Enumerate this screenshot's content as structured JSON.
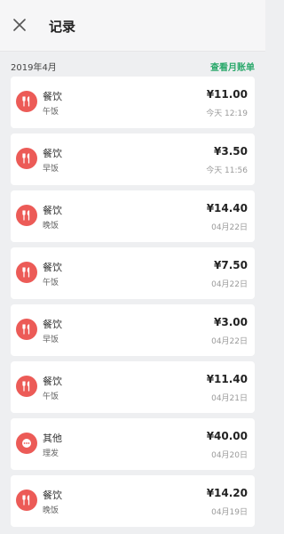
{
  "header": {
    "title": "记录"
  },
  "month": {
    "label": "2019年4月",
    "link": "查看月账单"
  },
  "records": [
    {
      "category": "餐饮",
      "note": "午饭",
      "amount": "¥11.00",
      "time": "今天 12:19",
      "icon": "fork-knife-icon"
    },
    {
      "category": "餐饮",
      "note": "早饭",
      "amount": "¥3.50",
      "time": "今天 11:56",
      "icon": "fork-knife-icon"
    },
    {
      "category": "餐饮",
      "note": "晚饭",
      "amount": "¥14.40",
      "time": "04月22日",
      "icon": "fork-knife-icon"
    },
    {
      "category": "餐饮",
      "note": "午饭",
      "amount": "¥7.50",
      "time": "04月22日",
      "icon": "fork-knife-icon"
    },
    {
      "category": "餐饮",
      "note": "早饭",
      "amount": "¥3.00",
      "time": "04月22日",
      "icon": "fork-knife-icon"
    },
    {
      "category": "餐饮",
      "note": "午饭",
      "amount": "¥11.40",
      "time": "04月21日",
      "icon": "fork-knife-icon"
    },
    {
      "category": "其他",
      "note": "理发",
      "amount": "¥40.00",
      "time": "04月20日",
      "icon": "more-dots-icon"
    },
    {
      "category": "餐饮",
      "note": "晚饭",
      "amount": "¥14.20",
      "time": "04月19日",
      "icon": "fork-knife-icon"
    }
  ],
  "colors": {
    "icon_bg": "#ec5b57",
    "link": "#2aa86b"
  }
}
